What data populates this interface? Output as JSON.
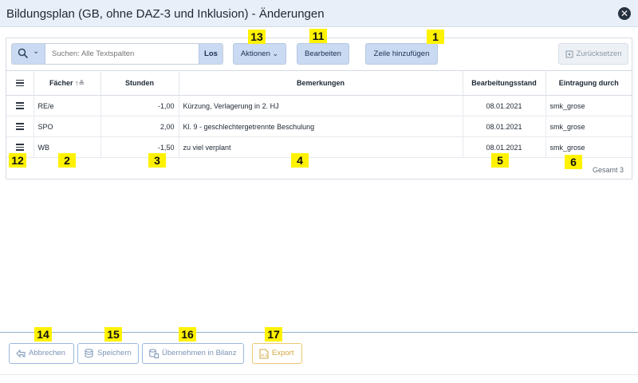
{
  "window": {
    "title": "Bildungsplan (GB, ohne DAZ-3 und Inklusion) - Änderungen",
    "close_icon": "close-icon"
  },
  "toolbar": {
    "search_placeholder": "Suchen: Alle Textspalten",
    "search_go": "Los",
    "actions": "Aktionen",
    "edit": "Bearbeiten",
    "add_row": "Zeile hinzufügen",
    "reset": "Zurücksetzen"
  },
  "table": {
    "columns": [
      "Fächer",
      "Stunden",
      "Bemerkungen",
      "Bearbeitungsstand",
      "Eintragung durch"
    ],
    "rows": [
      {
        "fach": "RE/e",
        "stunden": "-1,00",
        "bemerkung": "Kürzung, Verlagerung in 2. HJ",
        "stand": "08.01.2021",
        "durch": "smk_grose"
      },
      {
        "fach": "SPO",
        "stunden": "2,00",
        "bemerkung": "Kl. 9 - geschlechtergetrennte Beschulung",
        "stand": "08.01.2021",
        "durch": "smk_grose"
      },
      {
        "fach": "WB",
        "stunden": "-1,50",
        "bemerkung": "zu viel verplant",
        "stand": "08.01.2021",
        "durch": "smk_grose"
      }
    ],
    "total": "Gesamt 3"
  },
  "footer": {
    "cancel": "Abbrechen",
    "save": "Speichern",
    "apply": "Übernehmen in Bilanz",
    "export": "Export"
  },
  "markers": {
    "m1": "1",
    "m2": "2",
    "m3": "3",
    "m4": "4",
    "m5": "5",
    "m6": "6",
    "m11": "11",
    "m12": "12",
    "m13": "13",
    "m14": "14",
    "m15": "15",
    "m16": "16",
    "m17": "17"
  },
  "colors": {
    "accent": "#c9daf2",
    "marker": "#fff200",
    "export": "#d3a742"
  }
}
